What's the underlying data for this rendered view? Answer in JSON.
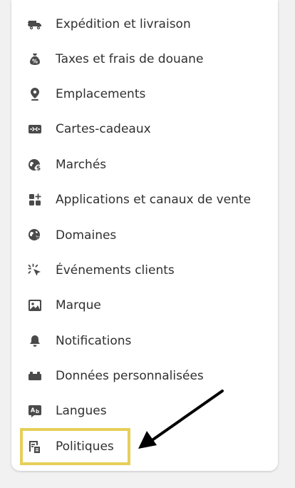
{
  "menu": {
    "items": [
      {
        "label": "Expédition et livraison",
        "icon": "truck-icon"
      },
      {
        "label": "Taxes et frais de douane",
        "icon": "money-bag-icon"
      },
      {
        "label": "Emplacements",
        "icon": "location-pin-icon"
      },
      {
        "label": "Cartes-cadeaux",
        "icon": "gift-card-icon"
      },
      {
        "label": "Marchés",
        "icon": "globe-dollar-icon"
      },
      {
        "label": "Applications et canaux de vente",
        "icon": "apps-plus-icon"
      },
      {
        "label": "Domaines",
        "icon": "globe-cursor-icon"
      },
      {
        "label": "Événements clients",
        "icon": "cursor-click-icon"
      },
      {
        "label": "Marque",
        "icon": "image-icon"
      },
      {
        "label": "Notifications",
        "icon": "bell-icon"
      },
      {
        "label": "Données personnalisées",
        "icon": "database-icon"
      },
      {
        "label": "Langues",
        "icon": "translate-icon"
      },
      {
        "label": "Politiques",
        "icon": "policy-icon"
      }
    ]
  },
  "colors": {
    "highlight": "#e6cf59",
    "icon": "#4a4a4a",
    "text": "#303030",
    "arrow": "#000000"
  }
}
